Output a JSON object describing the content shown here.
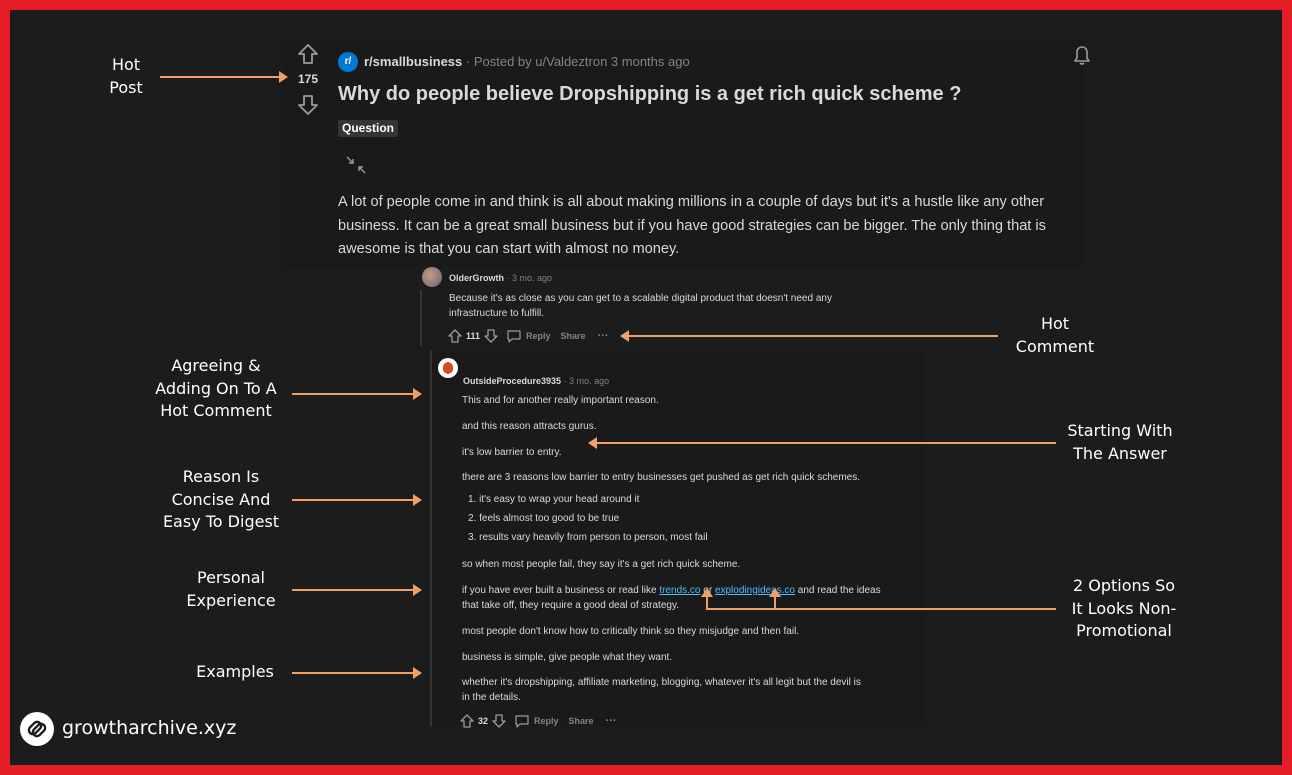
{
  "post": {
    "subreddit": "r/smallbusiness",
    "subreddit_icon": "r/",
    "posted_by": "· Posted by u/Valdeztron 3 months ago",
    "votes": "175",
    "title": "Why do people believe Dropshipping is a get rich quick scheme ?",
    "flair": "Question",
    "body": "A lot of people come in and think is all about making millions in a couple of days but it's a hustle like any other business. It can be a great small business but if you have good strategies can be bigger. The only thing that is awesome is that you can start with almost no money."
  },
  "comment1": {
    "author": "OlderGrowth",
    "time": "· 3 mo. ago",
    "text": "Because it's as close as you can get to a scalable digital product that doesn't need any infrastructure to fulfill.",
    "votes": "111",
    "reply_label": "Reply",
    "share_label": "Share",
    "more": "···"
  },
  "comment2": {
    "author": "OutsideProcedure3935",
    "time": "· 3 mo. ago",
    "p1": "This and for another really important reason.",
    "p2": "and this reason attracts gurus.",
    "p3": "it's low barrier to entry.",
    "p4": "there are 3 reasons low barrier to entry businesses get pushed as get rich quick schemes.",
    "list": [
      "1. it's easy to wrap your head around it",
      "2. feels almost too good to be true",
      "3. results vary heavily from person to person, most fail"
    ],
    "p5": "so when most people fail, they say it's a get rich quick scheme.",
    "p6_a": "if you have ever built a business or read like ",
    "link1": "trends.co",
    "p6_b": " or ",
    "link2": "explodingideas.co",
    "p6_c": " and read the ideas",
    "p6_d": "that take off, they require a good deal of strategy.",
    "p7": "most people don't know how to critically think so they misjudge and then fail.",
    "p8": "business is simple, give people what they want.",
    "p9a": "whether it's dropshipping, affiliate marketing, blogging, whatever it's all legit but the devil is",
    "p9b": "in the details.",
    "votes": "32",
    "reply_label": "Reply",
    "share_label": "Share",
    "more": "···"
  },
  "annotations": {
    "hot_post": [
      "Hot",
      "Post"
    ],
    "hot_comment": [
      "Hot",
      "Comment"
    ],
    "agreeing": [
      "Agreeing &",
      "Adding On To A",
      "Hot Comment"
    ],
    "reason": [
      "Reason Is",
      "Concise And",
      "Easy To Digest"
    ],
    "personal": [
      "Personal",
      "Experience"
    ],
    "examples": [
      "Examples"
    ],
    "starting": [
      "Starting With",
      "The Answer"
    ],
    "options": [
      "2 Options So",
      "It Looks Non-",
      "Promotional"
    ]
  },
  "brand": {
    "name": "growtharchive.xyz"
  },
  "colors": {
    "frame": "#e41e26",
    "background": "#1c1c1c",
    "arrow": "#f0a065",
    "link": "#4fbcff",
    "subreddit_icon": "#0079d3"
  }
}
